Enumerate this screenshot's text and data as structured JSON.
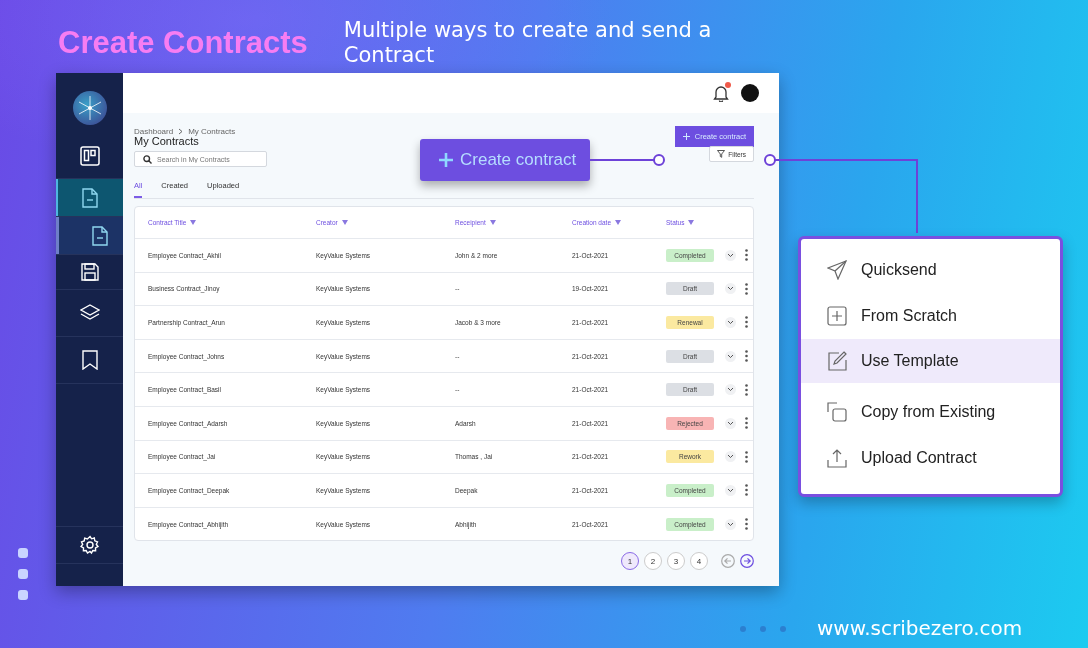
{
  "header": {
    "title": "Create Contracts",
    "subtitle": "Multiple ways to create and send a Contract"
  },
  "app": {
    "sidebar": {
      "items": [
        {
          "selected": false
        },
        {
          "selected": true
        },
        {
          "selected": true
        },
        {
          "selected": false
        },
        {
          "selected": false
        },
        {
          "selected": false
        },
        {
          "selected": false
        }
      ]
    },
    "notifications": {
      "unread": true
    },
    "breadcrumb": [
      "Dashboard",
      "My Contracts"
    ],
    "page_title": "My Contracts",
    "search": {
      "placeholder": "Search in My Contracts"
    },
    "create_button": "Create contract",
    "filters_button": "Filters",
    "tabs": [
      {
        "label": "All",
        "selected": true
      },
      {
        "label": "Created",
        "selected": false
      },
      {
        "label": "Uploaded",
        "selected": false
      }
    ],
    "table": {
      "columns": [
        "Contract Title",
        "Creator",
        "Receipient",
        "Creation date",
        "Status"
      ],
      "rows": [
        {
          "title": "Employee Contract_Akhil",
          "creator": "KeyValue Systems",
          "recipient": "John & 2 more",
          "date": "21-Oct-2021",
          "status": {
            "label": "Completed",
            "color": "#c9efc9"
          }
        },
        {
          "title": "Business Contract_Jinoy",
          "creator": "KeyValue Systems",
          "recipient": "--",
          "date": "19-Oct-2021",
          "status": {
            "label": "Draft",
            "color": "#dcdfe4"
          }
        },
        {
          "title": "Partnership Contract_Arun",
          "creator": "KeyValue Systems",
          "recipient": "Jacob & 3 more",
          "date": "21-Oct-2021",
          "status": {
            "label": "Renewal",
            "color": "#fbe9a0"
          }
        },
        {
          "title": "Employee Contract_Johns",
          "creator": "KeyValue Systems",
          "recipient": "--",
          "date": "21-Oct-2021",
          "status": {
            "label": "Draft",
            "color": "#dcdfe4"
          }
        },
        {
          "title": "Employee Contract_Basil",
          "creator": "KeyValue Systems",
          "recipient": "--",
          "date": "21-Oct-2021",
          "status": {
            "label": "Draft",
            "color": "#dcdfe4"
          }
        },
        {
          "title": "Employee Contract_Adarsh",
          "creator": "KeyValue Systems",
          "recipient": "Adarsh",
          "date": "21-Oct-2021",
          "status": {
            "label": "Rejected",
            "color": "#f8b4b4"
          }
        },
        {
          "title": "Employee Contract_Jai",
          "creator": "KeyValue Systems",
          "recipient": "Thomas , Jai",
          "date": "21-Oct-2021",
          "status": {
            "label": "Rework",
            "color": "#fbe9a0"
          }
        },
        {
          "title": "Employee Contract_Deepak",
          "creator": "KeyValue Systems",
          "recipient": "Deepak",
          "date": "21-Oct-2021",
          "status": {
            "label": "Completed",
            "color": "#c9efc9"
          }
        },
        {
          "title": "Employee Contract_Abhijith",
          "creator": "KeyValue Systems",
          "recipient": "Abhijith",
          "date": "21-Oct-2021",
          "status": {
            "label": "Completed",
            "color": "#c9efc9"
          }
        }
      ]
    },
    "pagination": {
      "pages": [
        {
          "label": "1",
          "selected": true
        },
        {
          "label": "2",
          "selected": false
        },
        {
          "label": "3",
          "selected": false
        },
        {
          "label": "4",
          "selected": false
        }
      ],
      "prev": {
        "disabled": true
      },
      "next": {
        "disabled": false
      }
    }
  },
  "callout": {
    "label": "Create contract"
  },
  "menu": {
    "items": [
      {
        "label": "Quicksend",
        "selected": false
      },
      {
        "label": "From Scratch",
        "selected": false
      },
      {
        "label": "Use Template",
        "selected": true
      },
      {
        "label": "Copy from Existing",
        "selected": false
      },
      {
        "label": "Upload Contract",
        "selected": false
      }
    ]
  },
  "website": "www.scribezero.com"
}
